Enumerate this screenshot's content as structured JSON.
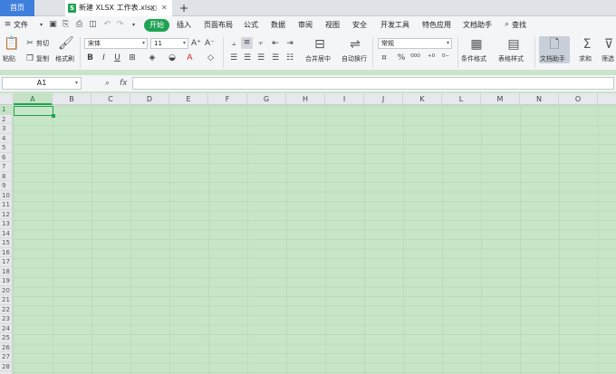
{
  "tabs": {
    "home": "首页",
    "doc_badge": "S",
    "doc": "新建 XLSX 工作表.xlsx",
    "add": "+"
  },
  "menu": {
    "file": "文件",
    "items": [
      "开始",
      "插入",
      "页面布局",
      "公式",
      "数据",
      "审阅",
      "视图",
      "安全",
      "开发工具",
      "特色应用",
      "文档助手",
      "查找"
    ]
  },
  "ribbon": {
    "paste": "粘贴",
    "cut": "剪切",
    "copy": "复制",
    "format_painter": "格式刷",
    "font_name": "宋体",
    "font_size": "11",
    "merge_center": "合并居中",
    "wrap_text": "自动换行",
    "number_format": "常规",
    "percent": "%",
    "cond_format": "条件格式",
    "table_style": "表格样式",
    "doc_helper": "文档助手",
    "sum": "求和",
    "filter": "筛选"
  },
  "formula_bar": {
    "name_box": "A1",
    "fx": "fx"
  },
  "grid": {
    "columns": [
      "A",
      "B",
      "C",
      "D",
      "E",
      "F",
      "G",
      "H",
      "I",
      "J",
      "K",
      "L",
      "M",
      "N",
      "O"
    ],
    "rows": [
      "1",
      "2",
      "3",
      "4",
      "5",
      "6",
      "7",
      "8",
      "9",
      "10",
      "11",
      "12",
      "13",
      "14",
      "15",
      "16",
      "17",
      "18",
      "19",
      "20",
      "21",
      "22",
      "23",
      "24",
      "25",
      "26",
      "27",
      "28"
    ],
    "selected_cell": "A1"
  },
  "colors": {
    "accent": "#1fa254",
    "home_tab": "#3f7fdc",
    "sheet_bg": "#c7e6c7"
  }
}
